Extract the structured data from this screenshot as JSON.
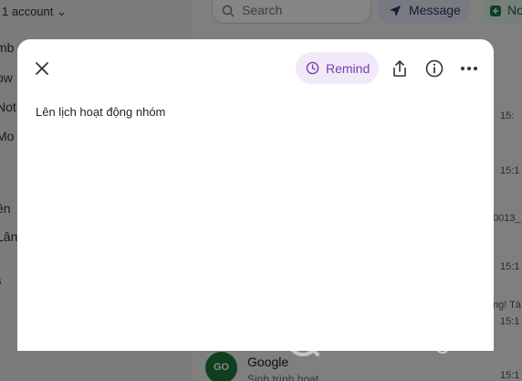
{
  "background": {
    "account_label": "1 account",
    "search_placeholder": "Search",
    "message_button": "Message",
    "new_button": "No",
    "sidebar_fragments": [
      "mb",
      "ow",
      "Not",
      "Mo",
      "t",
      "ên",
      "Lâng",
      "s"
    ],
    "times": [
      "15:",
      "15:1",
      "15:1",
      "15:1",
      "15:1"
    ],
    "snippets": [
      "0013_",
      "ng! Tà"
    ],
    "google": {
      "avatar": "GO",
      "name": "Google",
      "sub": "Sinh trình hoạt..."
    }
  },
  "modal": {
    "remind_label": "Remind",
    "note_text": "Lên lịch hoạt động nhóm"
  },
  "watermark": {
    "text": "uantrimang"
  },
  "colors": {
    "remind_bg": "#f1e9f8",
    "remind_fg": "#7a3db0"
  }
}
